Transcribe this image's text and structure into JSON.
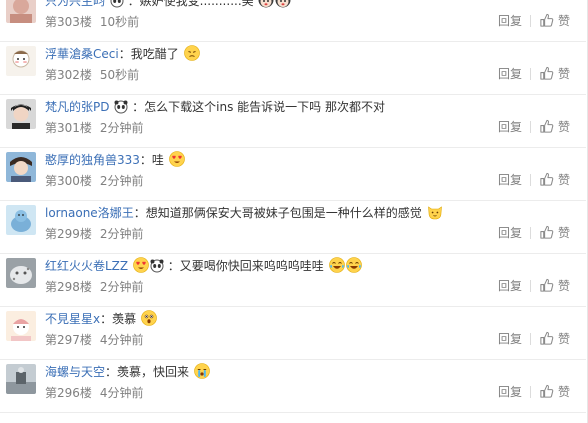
{
  "colors": {
    "username": "#3b6fb6",
    "meta": "#808080",
    "divider": "#ececec"
  },
  "actions": {
    "reply_label": "回复",
    "like_label": "赞"
  },
  "comments": [
    {
      "user": "只为兴生畇",
      "user_badge": "panda-icon",
      "text": "：嫉妒使我变...........美",
      "emojis": [
        "girl-face-emoji",
        "girl-face-emoji"
      ],
      "floor": "第303楼",
      "time": "10秒前"
    },
    {
      "user": "浮華滄桑Ceci",
      "text": "：我吃醋了",
      "emojis": [
        "sour-face-emoji"
      ],
      "floor": "第302楼",
      "time": "50秒前"
    },
    {
      "user": "梵凡的张PD",
      "user_badge": "panda-icon",
      "text": "：怎么下载这个ins 能告诉说一下吗 那次都不对",
      "emojis": [],
      "floor": "第301楼",
      "time": "2分钟前"
    },
    {
      "user": "憨厚的独角兽333",
      "text": "：哇",
      "emojis": [
        "heart-eyes-emoji"
      ],
      "floor": "第300楼",
      "time": "2分钟前"
    },
    {
      "user": "lornaone洛娜王",
      "text": "：想知道那俩保安大哥被妹子包围是一种什么样的感觉",
      "emojis": [
        "cat-face-emoji"
      ],
      "floor": "第299楼",
      "time": "2分钟前"
    },
    {
      "user": "红红火火卷LZZ",
      "user_badge": "panda-icon",
      "text": "：又要喝你快回来呜呜呜哇哇",
      "emojis": [
        "laughing-tears-emoji",
        "laughing-tears-emoji"
      ],
      "floor": "第298楼",
      "time": "2分钟前"
    },
    {
      "user": "不見星星x",
      "text": "：羡慕",
      "emojis": [
        "shocked-face-emoji"
      ],
      "floor": "第297楼",
      "time": "4分钟前"
    },
    {
      "user": "海螺与天空",
      "text": "：羡慕，快回来",
      "emojis": [
        "crying-face-emoji"
      ],
      "floor": "第296楼",
      "time": "4分钟前"
    }
  ]
}
